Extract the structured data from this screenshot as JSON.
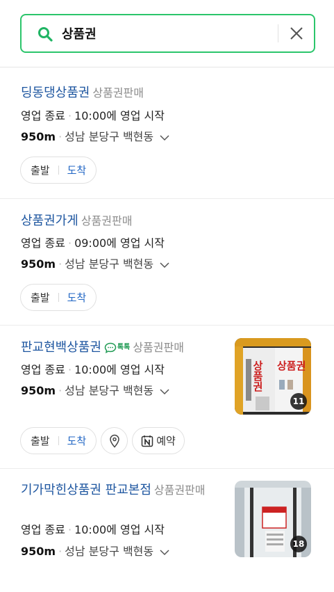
{
  "search": {
    "query": "상품권",
    "icon": "search-icon",
    "clear_icon": "close-icon",
    "accent": "#2bc56b"
  },
  "places": [
    {
      "name": "딩동댕상품권",
      "category": "상품권판매",
      "status": "영업 종료",
      "hours": "10:00에 영업 시작",
      "distance": "950m",
      "address": "성남 분당구 백현동",
      "buttons": {
        "start": "출발",
        "arrive": "도착"
      }
    },
    {
      "name": "상품권가게",
      "category": "상품권판매",
      "status": "영업 종료",
      "hours": "09:00에 영업 시작",
      "distance": "950m",
      "address": "성남 분당구 백현동",
      "buttons": {
        "start": "출발",
        "arrive": "도착"
      }
    },
    {
      "name": "판교현백상품권",
      "talk_badge": "톡톡",
      "category": "상품권판매",
      "status": "영업 종료",
      "hours": "10:00에 영업 시작",
      "distance": "950m",
      "address": "성남 분당구 백현동",
      "photo_count": "11",
      "photo_sign": "상품권",
      "buttons": {
        "start": "출발",
        "arrive": "도착",
        "reserve": "예약"
      }
    },
    {
      "name": "기가막힌상품권 판교본점",
      "category": "상품권판매",
      "status": "영업 종료",
      "hours": "10:00에 영업 시작",
      "distance": "950m",
      "address": "성남 분당구 백현동",
      "photo_count": "18"
    }
  ]
}
